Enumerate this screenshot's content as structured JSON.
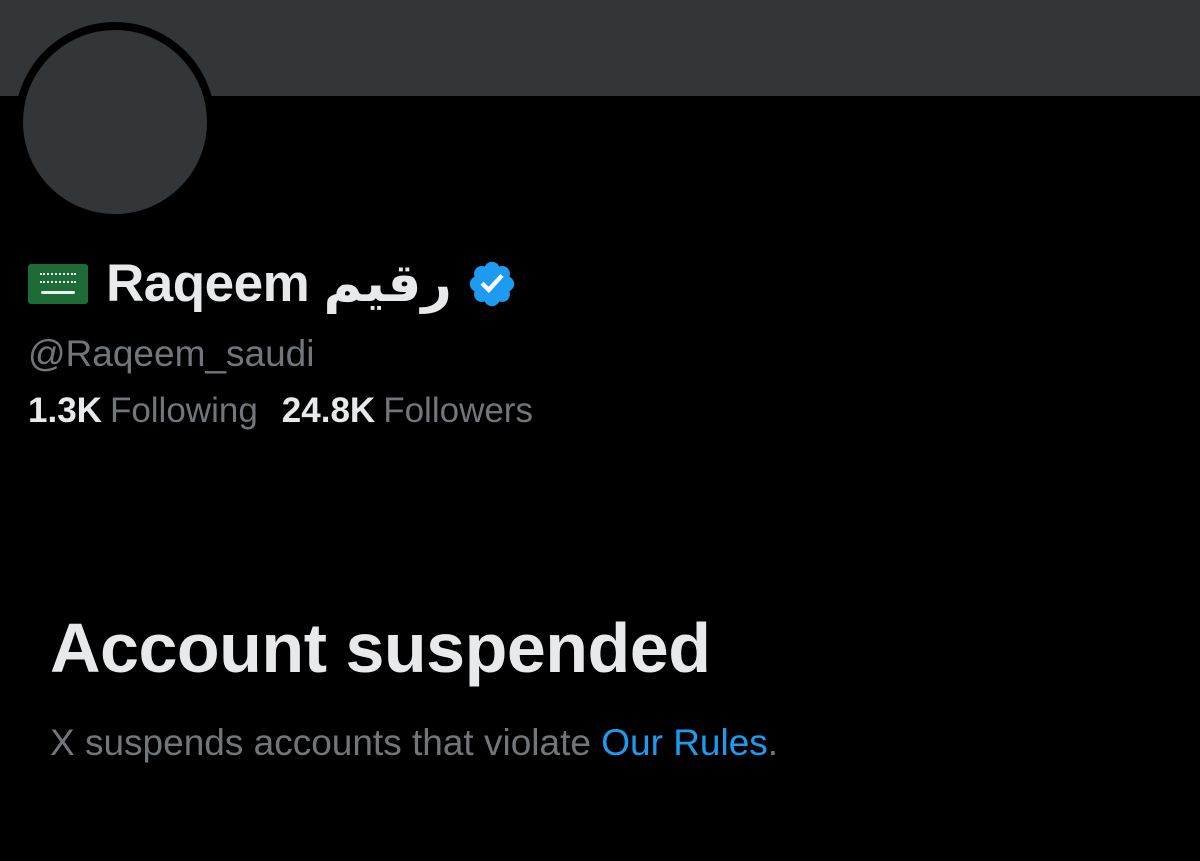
{
  "colors": {
    "background": "#000000",
    "banner": "#333639",
    "text_primary": "#e7e9ea",
    "text_secondary": "#71767b",
    "link": "#1d9bf0",
    "verified": "#1d9bf0"
  },
  "profile": {
    "flag_icon": "saudi-flag-icon",
    "display_name": "Raqeem رقيم",
    "verified_icon": "verified-badge-icon",
    "handle": "@Raqeem_saudi",
    "following_count": "1.3K",
    "following_label": "Following",
    "followers_count": "24.8K",
    "followers_label": "Followers"
  },
  "suspension": {
    "title": "Account suspended",
    "message_prefix": "X suspends accounts that violate ",
    "rules_link": "Our Rules",
    "message_suffix": "."
  }
}
